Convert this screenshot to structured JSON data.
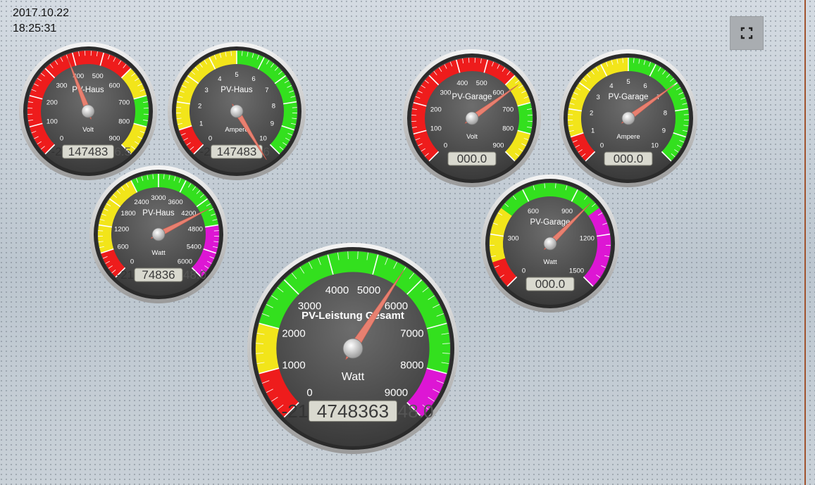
{
  "header": {
    "date": "2017.10.22",
    "time": "18:25:31"
  },
  "fullscreen_icon": "fullscreen-icon",
  "colors": {
    "red": "#ee1c1c",
    "yellow": "#f2e51a",
    "green": "#33e01e",
    "magenta": "#dd16d4",
    "needle": "#e88070",
    "face": "#4a4a4a",
    "accent_line": "#a0522d"
  },
  "gauges": [
    {
      "id": "pv-haus-volt",
      "title": "PV-Haus",
      "unit": "Volt",
      "min": 0,
      "max": 900,
      "ticks": [
        "0",
        "100",
        "200",
        "300",
        "400",
        "500",
        "600",
        "700",
        "800",
        "900"
      ],
      "zones": [
        {
          "from": 0,
          "to": 600,
          "color": "red"
        },
        {
          "from": 600,
          "to": 700,
          "color": "yellow"
        },
        {
          "from": 700,
          "to": 800,
          "color": "green"
        },
        {
          "from": 800,
          "to": 900,
          "color": "yellow"
        }
      ],
      "value": 380,
      "readout": "-2147483",
      "readout_left": "-2",
      "readout_box": "147483",
      "readout_right": "6.5"
    },
    {
      "id": "pv-haus-ampere",
      "title": "PV-Haus",
      "unit": "Ampere",
      "min": 0,
      "max": 10,
      "ticks": [
        "0",
        "1",
        "2",
        "3",
        "4",
        "5",
        "6",
        "7",
        "8",
        "9",
        "10"
      ],
      "zones": [
        {
          "from": 0,
          "to": 1,
          "color": "red"
        },
        {
          "from": 1,
          "to": 5,
          "color": "yellow"
        },
        {
          "from": 5,
          "to": 10,
          "color": "green"
        }
      ],
      "value": 10.5,
      "readout_left": "-2",
      "readout_box": "147483",
      "readout_right": "6"
    },
    {
      "id": "pv-haus-watt",
      "title": "PV-Haus",
      "unit": "Watt",
      "min": 0,
      "max": 6000,
      "ticks": [
        "0",
        "600",
        "1200",
        "1800",
        "2400",
        "3000",
        "3600",
        "4200",
        "4800",
        "5400",
        "6000"
      ],
      "zones": [
        {
          "from": 0,
          "to": 600,
          "color": "red"
        },
        {
          "from": 600,
          "to": 2400,
          "color": "yellow"
        },
        {
          "from": 2400,
          "to": 4800,
          "color": "green"
        },
        {
          "from": 4800,
          "to": 6000,
          "color": "magenta"
        }
      ],
      "value": 4400,
      "readout_left": "-21",
      "readout_box": "74836",
      "readout_right": "48.0"
    },
    {
      "id": "pv-leistung-gesamt",
      "title": "PV-Leistung Gesamt",
      "unit": "Watt",
      "min": 0,
      "max": 9000,
      "ticks": [
        "0",
        "1000",
        "2000",
        "3000",
        "4000",
        "5000",
        "6000",
        "7000",
        "8000",
        "9000"
      ],
      "zones": [
        {
          "from": 0,
          "to": 1000,
          "color": "red"
        },
        {
          "from": 1000,
          "to": 2000,
          "color": "yellow"
        },
        {
          "from": 2000,
          "to": 8000,
          "color": "green"
        },
        {
          "from": 8000,
          "to": 9000,
          "color": "magenta"
        }
      ],
      "value": 5600,
      "readout_left": "-21",
      "readout_box": "4748363",
      "readout_right": "48.0"
    },
    {
      "id": "pv-garage-volt",
      "title": "PV-Garage",
      "unit": "Volt",
      "min": 0,
      "max": 900,
      "ticks": [
        "0",
        "100",
        "200",
        "300",
        "400",
        "500",
        "600",
        "700",
        "800",
        "900"
      ],
      "zones": [
        {
          "from": 0,
          "to": 600,
          "color": "red"
        },
        {
          "from": 600,
          "to": 700,
          "color": "yellow"
        },
        {
          "from": 700,
          "to": 800,
          "color": "green"
        },
        {
          "from": 800,
          "to": 900,
          "color": "yellow"
        }
      ],
      "value": 630,
      "readout_left": "",
      "readout_box": "000.0",
      "readout_right": ""
    },
    {
      "id": "pv-garage-ampere",
      "title": "PV-Garage",
      "unit": "Ampere",
      "min": 0,
      "max": 10,
      "ticks": [
        "0",
        "1",
        "2",
        "3",
        "4",
        "5",
        "6",
        "7",
        "8",
        "9",
        "10"
      ],
      "zones": [
        {
          "from": 0,
          "to": 1,
          "color": "red"
        },
        {
          "from": 1,
          "to": 5,
          "color": "yellow"
        },
        {
          "from": 5,
          "to": 10,
          "color": "green"
        }
      ],
      "value": 7,
      "readout_left": "",
      "readout_box": "000.0",
      "readout_right": ""
    },
    {
      "id": "pv-garage-watt",
      "title": "PV-Garage",
      "unit": "Watt",
      "min": 0,
      "max": 1500,
      "ticks": [
        "0",
        "300",
        "600",
        "900",
        "1200",
        "1500"
      ],
      "zones": [
        {
          "from": 0,
          "to": 150,
          "color": "red"
        },
        {
          "from": 150,
          "to": 450,
          "color": "yellow"
        },
        {
          "from": 450,
          "to": 1050,
          "color": "green"
        },
        {
          "from": 1050,
          "to": 1500,
          "color": "magenta"
        }
      ],
      "value": 1000,
      "readout_left": "",
      "readout_box": "000.0",
      "readout_right": ""
    }
  ]
}
